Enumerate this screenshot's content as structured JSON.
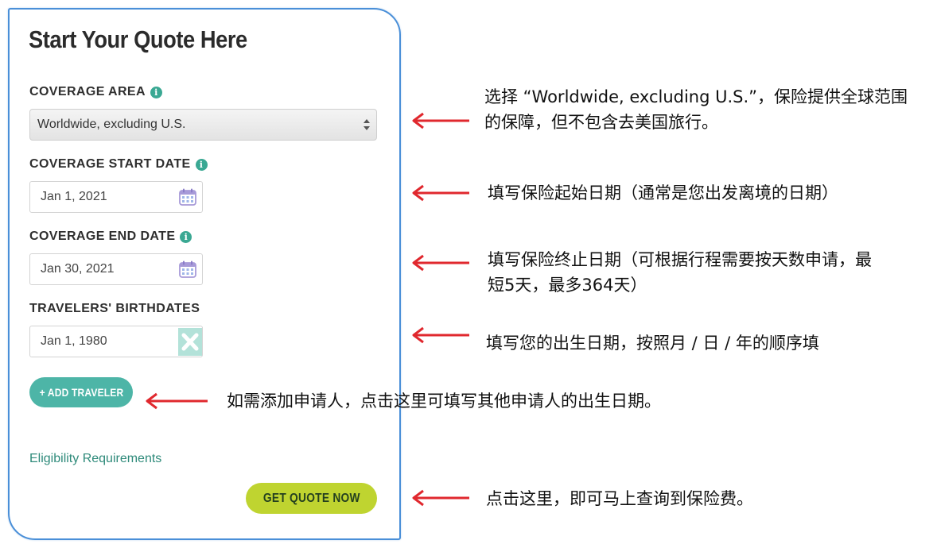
{
  "form": {
    "title": "Start Your Quote Here",
    "coverage_area": {
      "label": "COVERAGE AREA",
      "value": "Worldwide, excluding U.S."
    },
    "start_date": {
      "label": "COVERAGE START DATE",
      "value": "Jan 1, 2021"
    },
    "end_date": {
      "label": "COVERAGE END DATE",
      "value": "Jan 30, 2021"
    },
    "birthdates": {
      "label": "TRAVELERS' BIRTHDATES",
      "value": "Jan 1, 1980"
    },
    "add_traveler_label": "+ ADD TRAVELER",
    "eligibility_link": "Eligibility Requirements",
    "get_quote_label": "GET QUOTE NOW",
    "info_icon_glyph": "i"
  },
  "annotations": {
    "coverage_area_line1": "选择 “Worldwide, excluding U.S.”，保险提供全球范围",
    "coverage_area_line2": "的保障，但不包含去美国旅行。",
    "start_date": "填写保险起始日期（通常是您出发离境的日期）",
    "end_date_line1": "填写保险终止日期（可根据行程需要按天数申请，最",
    "end_date_line2": "短5天，最多364天）",
    "birthdate": "填写您的出生日期，按照月 / 日 / 年的顺序填",
    "add_traveler": "如需添加申请人，点击这里可填写其他申请人的出生日期。",
    "get_quote": "点击这里，即可马上查询到保险费。"
  },
  "colors": {
    "card_border": "#4a8fd8",
    "accent_teal": "#4db5a7",
    "quote_button": "#bfd430",
    "arrow": "#e0282e"
  },
  "icons": [
    "info-icon",
    "calendar-icon",
    "clear-x-icon",
    "select-arrows-icon",
    "arrow-left-icon"
  ]
}
